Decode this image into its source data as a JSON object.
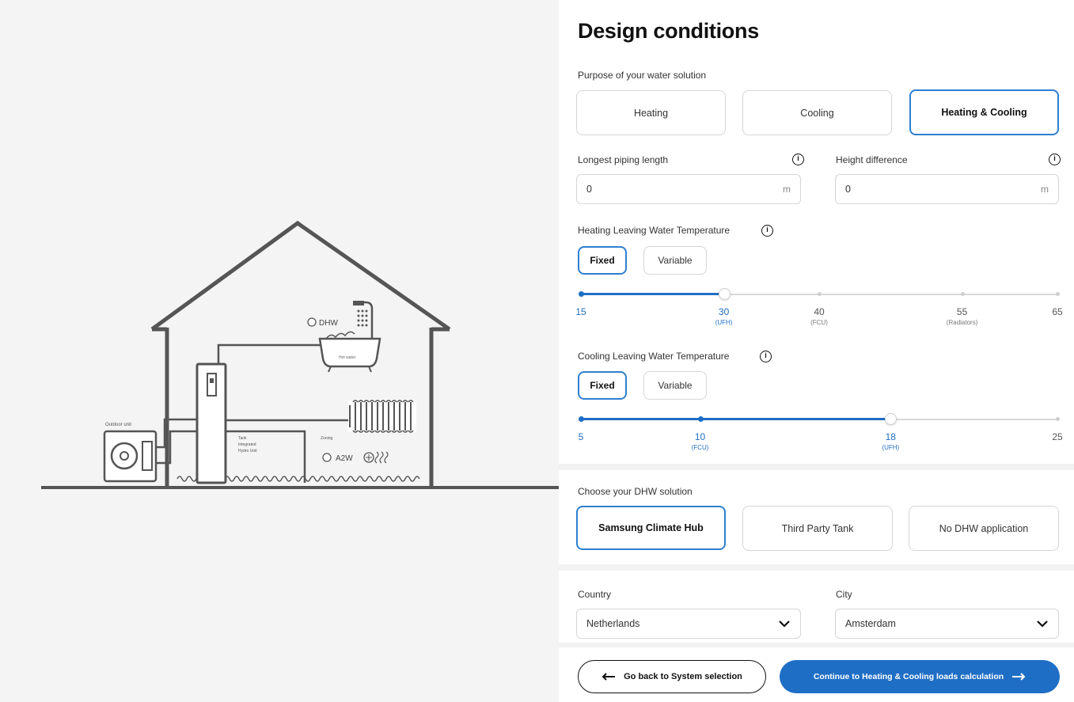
{
  "illustration": {
    "dhw_label": "DHW",
    "hot_water_label": "Hot water",
    "outdoor_unit_label": "Outdoor unit",
    "tank_label_1": "Tank",
    "tank_label_2": "Integrated",
    "tank_label_3": "Hydro Unit",
    "zoning_label": "Zoning",
    "a2w_label": "A2W"
  },
  "form": {
    "title": "Design conditions",
    "purpose": {
      "label": "Purpose of your water solution",
      "options": [
        "Heating",
        "Cooling",
        "Heating & Cooling"
      ],
      "selected": "Heating & Cooling"
    },
    "piping": {
      "label": "Longest piping length",
      "value": "0",
      "unit": "m"
    },
    "height": {
      "label": "Height difference",
      "value": "0",
      "unit": "m"
    },
    "heating_lwt": {
      "label": "Heating Leaving Water Temperature",
      "modes": [
        "Fixed",
        "Variable"
      ],
      "selected_mode": "Fixed",
      "min": 15,
      "max": 65,
      "value": 30,
      "ticks": [
        {
          "value": 15,
          "label": "15",
          "sub": ""
        },
        {
          "value": 30,
          "label": "30",
          "sub": "(UFH)"
        },
        {
          "value": 40,
          "label": "40",
          "sub": "(FCU)"
        },
        {
          "value": 55,
          "label": "55",
          "sub": "(Radiators)"
        },
        {
          "value": 65,
          "label": "65",
          "sub": ""
        }
      ]
    },
    "cooling_lwt": {
      "label": "Cooling Leaving Water Temperature",
      "modes": [
        "Fixed",
        "Variable"
      ],
      "selected_mode": "Fixed",
      "min": 5,
      "max": 25,
      "value": 18,
      "ticks": [
        {
          "value": 5,
          "label": "5",
          "sub": ""
        },
        {
          "value": 10,
          "label": "10",
          "sub": "(FCU)"
        },
        {
          "value": 18,
          "label": "18",
          "sub": "(UFH)"
        },
        {
          "value": 25,
          "label": "25",
          "sub": ""
        }
      ]
    },
    "dhw": {
      "label": "Choose your DHW solution",
      "options": [
        "Samsung Climate Hub",
        "Third Party Tank",
        "No DHW application"
      ],
      "selected": "Samsung Climate Hub"
    },
    "country": {
      "label": "Country",
      "value": "Netherlands"
    },
    "city": {
      "label": "City",
      "value": "Amsterdam"
    },
    "back_button": "Go back to System selection",
    "continue_button": "Continue to Heating & Cooling loads calculation",
    "colors": {
      "accent": "#1f6ec5",
      "selected_border": "#2f7fd0"
    }
  }
}
